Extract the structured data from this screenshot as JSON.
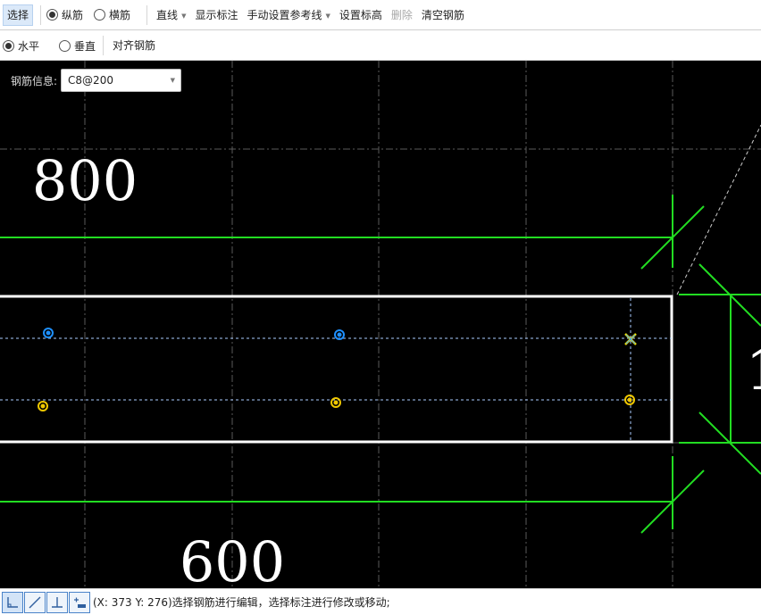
{
  "toolbar1": {
    "select": "选择",
    "longitudinal": "纵筋",
    "transverse": "横筋",
    "straight_line": "直线",
    "show_dimension": "显示标注",
    "manual_reference": "手动设置参考线",
    "set_elevation": "设置标高",
    "delete": "删除",
    "clear_rebar": "清空钢筋"
  },
  "toolbar2": {
    "horizontal": "水平",
    "vertical": "垂直",
    "align_rebar": "对齐钢筋"
  },
  "rebar_info": {
    "label": "钢筋信息:",
    "value": "C8@200"
  },
  "dimensions": {
    "top": "800",
    "bottom": "600",
    "right_partial": "1"
  },
  "status": {
    "text": "(X: 373 Y: 276)选择钢筋进行编辑，选择标注进行修改或移动;",
    "buttons": [
      "orthogonal-icon",
      "line-icon",
      "perpendicular-icon",
      "snap-icon"
    ]
  },
  "colors": {
    "canvas_bg": "#000000",
    "dimension_line": "#22dd22",
    "section_outline": "#ffffff",
    "rebar_blue": "#1e90ff",
    "rebar_yellow": "#f0c800",
    "guide_line": "#aaccff"
  }
}
